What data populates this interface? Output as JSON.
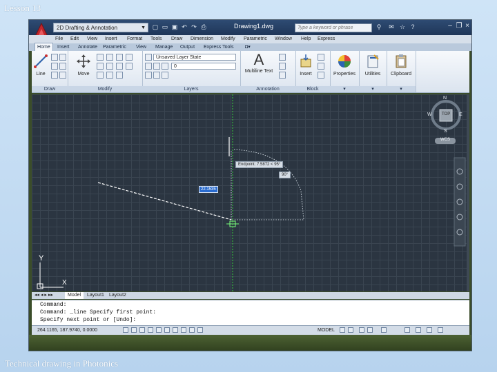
{
  "slide": {
    "title": "Lesson 13",
    "footer": "Technical drawing in Photonics"
  },
  "titlebar": {
    "workspace": "2D Drafting & Annotation",
    "document_title": "Drawing1.dwg",
    "search_placeholder": "Type a keyword or phrase"
  },
  "menubar": [
    "File",
    "Edit",
    "View",
    "Insert",
    "Format",
    "Tools",
    "Draw",
    "Dimension",
    "Modify",
    "Parametric",
    "Window",
    "Help",
    "Express"
  ],
  "ribbon_tabs": [
    "Home",
    "Insert",
    "Annotate",
    "Parametric",
    "View",
    "Manage",
    "Output",
    "Express Tools"
  ],
  "ribbon": {
    "panels": [
      "Draw",
      "Modify",
      "Layers",
      "Annotation",
      "Block",
      "Properties",
      "Utilities",
      "Clipboard"
    ],
    "line_label": "Line",
    "move_label": "Move",
    "layer_state": "Unsaved Layer State",
    "layer_current": "0",
    "multiline_text": "Multiline Text",
    "insert": "Insert",
    "properties": "Properties",
    "utilities": "Utilities",
    "clipboard": "Clipboard"
  },
  "canvas": {
    "compass_n": "N",
    "compass_s": "S",
    "compass_e": "E",
    "compass_w": "W",
    "compass_top": "TOP",
    "wcs": "WCS",
    "tooltip_endpoint": "Endpoint: 7.5872 < 95°",
    "tooltip_angle": "90°",
    "input_value": "22.1535",
    "ucs_y": "Y",
    "ucs_x": "X"
  },
  "layout_tabs": [
    "Model",
    "Layout1",
    "Layout2"
  ],
  "command": {
    "lines": [
      "Command:",
      "Command: _line Specify first point:",
      "Specify next point or [Undo]:"
    ]
  },
  "status": {
    "coords": "264.1165, 187.9740, 0.0000",
    "model": "MODEL"
  }
}
